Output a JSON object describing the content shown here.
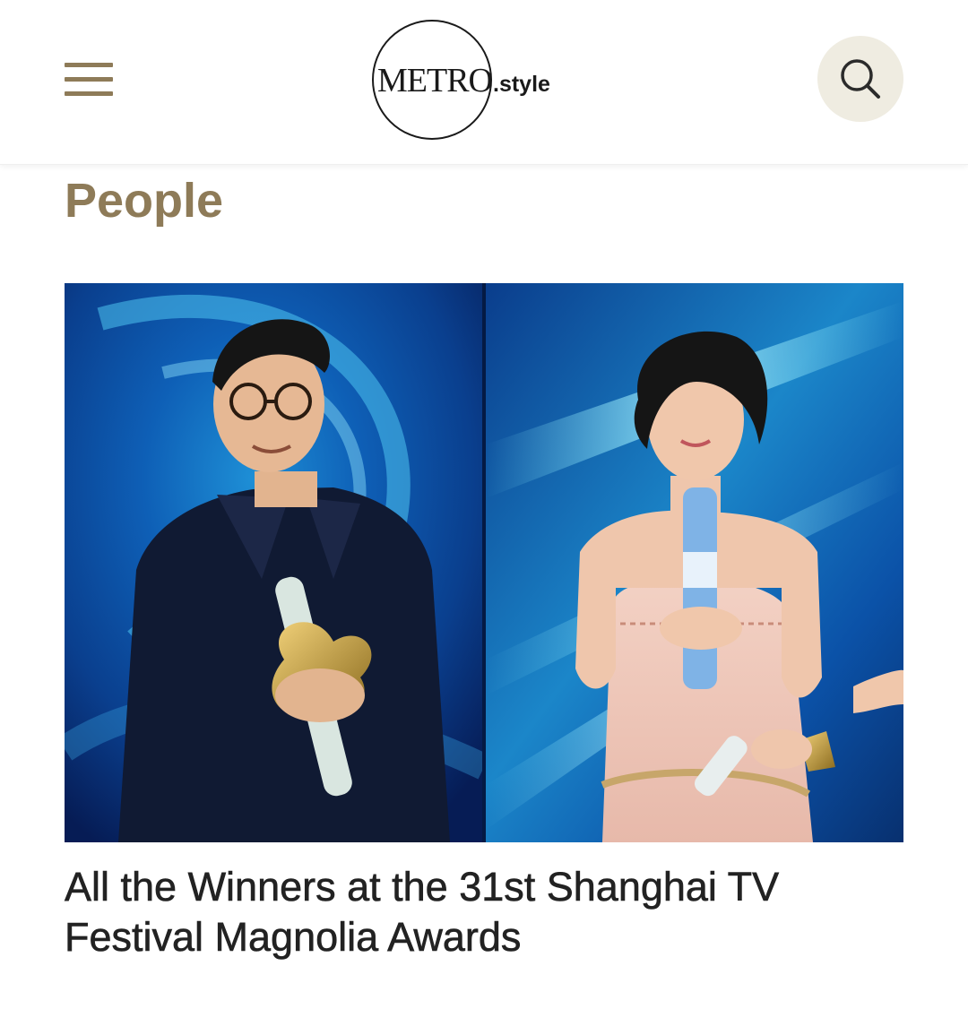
{
  "header": {
    "menu_icon": "hamburger-menu-icon",
    "logo": {
      "metro_text": "METRO",
      "suffix_text": ".style"
    },
    "search_icon": "search-icon",
    "colors": {
      "accent": "#8e7b58",
      "search_bg": "#efece1"
    }
  },
  "section": {
    "title": "People"
  },
  "article": {
    "image_alt": "Two award winners holding Magnolia trophies on stage",
    "title": "All the Winners at the 31st Shanghai TV Festival Magnolia Awards"
  }
}
